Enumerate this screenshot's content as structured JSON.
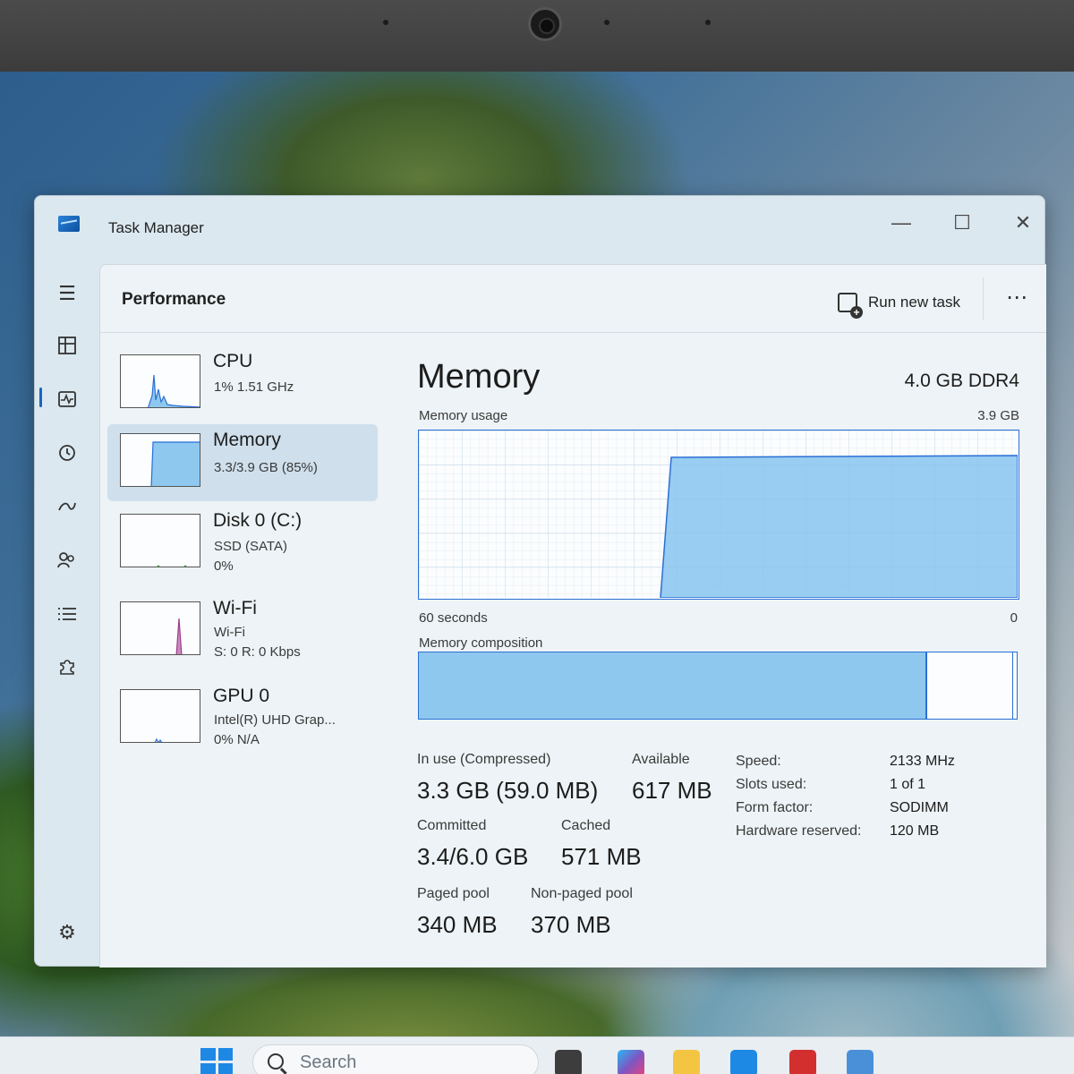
{
  "window": {
    "title": "Task Manager"
  },
  "panel": {
    "title": "Performance",
    "run_new_task": "Run new task",
    "more": "⋯"
  },
  "sidebar": {
    "devices": [
      {
        "name": "CPU",
        "line1": "1% 1.51 GHz",
        "line2": ""
      },
      {
        "name": "Memory",
        "line1": "3.3/3.9 GB (85%)",
        "line2": ""
      },
      {
        "name": "Disk 0 (C:)",
        "line1": "SSD (SATA)",
        "line2": "0%"
      },
      {
        "name": "Wi-Fi",
        "line1": "Wi-Fi",
        "line2": "S: 0 R: 0 Kbps"
      },
      {
        "name": "GPU 0",
        "line1": "Intel(R) UHD Grap...",
        "line2": "0% N/A"
      }
    ]
  },
  "memory": {
    "title": "Memory",
    "spec": "4.0 GB DDR4",
    "usage_label": "Memory usage",
    "usage_max": "3.9 GB",
    "time_label": "60 seconds",
    "zero_label": "0",
    "composition_label": "Memory composition",
    "composition_in_use_fraction": 0.85,
    "stats": {
      "in_use_label": "In use (Compressed)",
      "in_use_value": "3.3 GB (59.0 MB)",
      "available_label": "Available",
      "available_value": "617 MB",
      "committed_label": "Committed",
      "committed_value": "3.4/6.0 GB",
      "cached_label": "Cached",
      "cached_value": "571 MB",
      "paged_label": "Paged pool",
      "paged_value": "340 MB",
      "nonpaged_label": "Non-paged pool",
      "nonpaged_value": "370 MB"
    },
    "details": {
      "speed_label": "Speed:",
      "speed_value": "2133 MHz",
      "slots_label": "Slots used:",
      "slots_value": "1 of 1",
      "form_label": "Form factor:",
      "form_value": "SODIMM",
      "hwres_label": "Hardware reserved:",
      "hwres_value": "120 MB"
    }
  },
  "taskbar": {
    "search_placeholder": "Search"
  },
  "colors": {
    "accent": "#1a64c4",
    "graph_fill": "#8ec8ef",
    "graph_line": "#2a6fd6"
  }
}
